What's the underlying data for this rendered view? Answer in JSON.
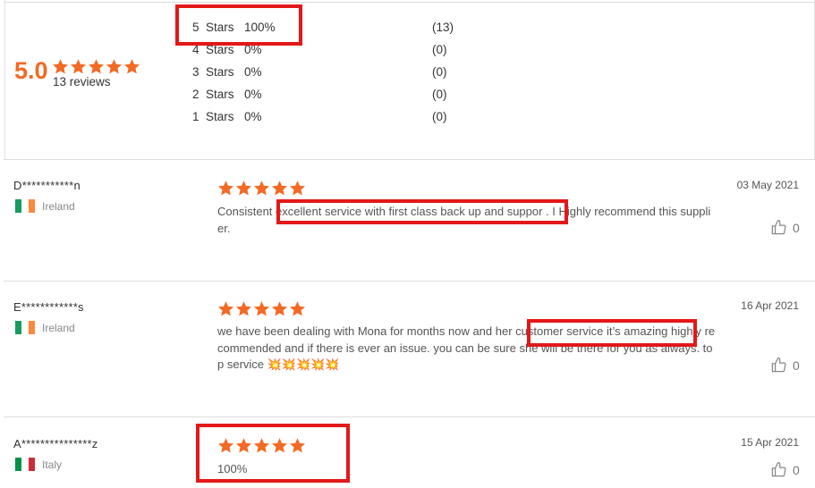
{
  "summary": {
    "score": "5.0",
    "reviews_count": "13 reviews",
    "distribution": [
      {
        "label": "5  Stars",
        "percent": "100%",
        "count": "(13)"
      },
      {
        "label": "4  Stars",
        "percent": "0%",
        "count": "(0)"
      },
      {
        "label": "3  Stars",
        "percent": "0%",
        "count": "(0)"
      },
      {
        "label": "2  Stars",
        "percent": "0%",
        "count": "(0)"
      },
      {
        "label": "1  Stars",
        "percent": "0%",
        "count": "(0)"
      }
    ]
  },
  "reviews": [
    {
      "reviewer": "D***********n",
      "country": "Ireland",
      "stars": 5,
      "text": "Consistent excellent service with first class back up and suppor . I Highly recommend this supplier.",
      "date": "03 May 2021",
      "helpful_count": "0"
    },
    {
      "reviewer": "E************s",
      "country": "Ireland",
      "stars": 5,
      "text": "we have been dealing with Mona for months now and her customer service it’s amazing highly recommended and if there is ever an issue. you can be sure she will be there for you as always. top service 💥💥💥💥💥",
      "date": "16 Apr 2021",
      "helpful_count": "0"
    },
    {
      "reviewer": "A***************z",
      "country": "Italy",
      "stars": 5,
      "text": "100%",
      "date": "15 Apr 2021",
      "helpful_count": "0"
    }
  ],
  "colors": {
    "star": "#f26a24",
    "highlight_box": "#e31818",
    "flag_ireland": [
      "#169b62",
      "#ffffff",
      "#ff883e"
    ],
    "flag_italy": [
      "#009246",
      "#ffffff",
      "#ce2b37"
    ]
  },
  "icons": {
    "star": "star-icon",
    "helpful": "thumbs-up-icon"
  }
}
